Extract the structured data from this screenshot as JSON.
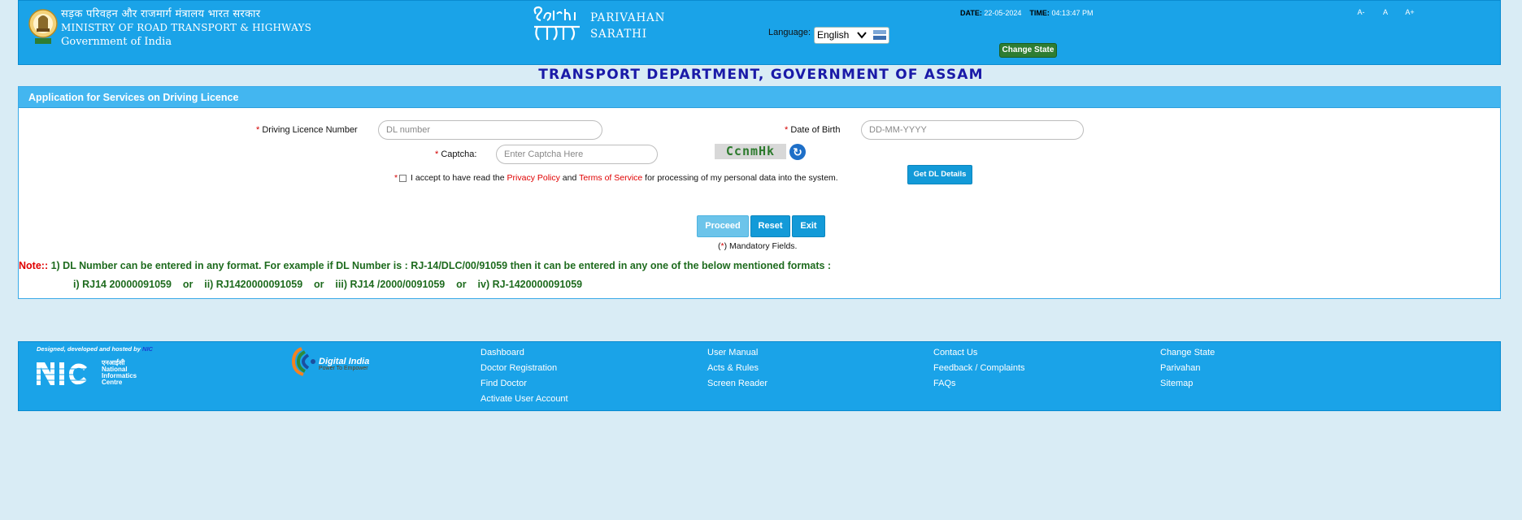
{
  "header": {
    "ministry_hindi": "सड़क परिवहन और राजमार्ग मंत्रालय भारत सरकार",
    "ministry_english": "MINISTRY OF ROAD TRANSPORT & HIGHWAYS",
    "government": "Government of India",
    "parivahan": "PARIVAHAN",
    "sarathi": "SARATHI",
    "language_label": "Language:",
    "language_value": "English",
    "date_label": "DATE:",
    "date_value": "22-05-2024",
    "time_label": "TIME:",
    "time_value": "04:13:47 PM",
    "change_state": "Change State",
    "font_decrease": "A-",
    "font_normal": "A",
    "font_increase": "A+"
  },
  "department_title": "TRANSPORT DEPARTMENT, GOVERNMENT OF ASSAM",
  "panel": {
    "title": "Application for Services on Driving Licence",
    "dl_number_label": "Driving Licence Number",
    "dl_number_placeholder": "DL number",
    "dob_label": "Date of Birth",
    "dob_placeholder": "DD-MM-YYYY",
    "captcha_label": "Captcha:",
    "captcha_placeholder": "Enter Captcha Here",
    "captcha_text": "CcnmHk",
    "consent_prefix": "I accept to have read the",
    "privacy_policy": "Privacy Policy",
    "and": "and",
    "terms_of_service": "Terms of Service",
    "consent_suffix": "for processing of my personal data into the system.",
    "get_dl_details": "Get DL Details",
    "proceed": "Proceed",
    "reset": "Reset",
    "exit": "Exit",
    "mandatory_marker": "*",
    "mandatory_text": "Mandatory Fields.",
    "note_label": "Note::",
    "note_line1": "1) DL Number can be entered in any format. For example if DL Number is : RJ-14/DLC/00/91059 then it can be entered in any one of the below mentioned formats :",
    "note_line2": "i) RJ14 20000091059    or    ii) RJ1420000091059    or    iii) RJ14 /2000/0091059    or    iv) RJ-1420000091059"
  },
  "footer": {
    "designed_by": "Designed, developed and hosted by",
    "designed_by_org": "NIC",
    "nic_hindi": "एनआईसी",
    "nic_line1": "National",
    "nic_line2": "Informatics",
    "nic_line3": "Centre",
    "digital_india": "Digital India",
    "digital_india_tag": "Power To Empower",
    "col1": [
      "Dashboard",
      "Doctor Registration",
      "Find Doctor",
      "Activate User Account"
    ],
    "col2": [
      "User Manual",
      "Acts & Rules",
      "Screen Reader"
    ],
    "col3": [
      "Contact Us",
      "Feedback / Complaints",
      "FAQs"
    ],
    "col4": [
      "Change State",
      "Parivahan",
      "Sitemap"
    ]
  },
  "colors": {
    "header_blue": "#1aa3e8",
    "title_blue": "#1a1aa8",
    "required_red": "#d30000",
    "note_green": "#1e6b1e",
    "change_state_green": "#2e7d32"
  }
}
